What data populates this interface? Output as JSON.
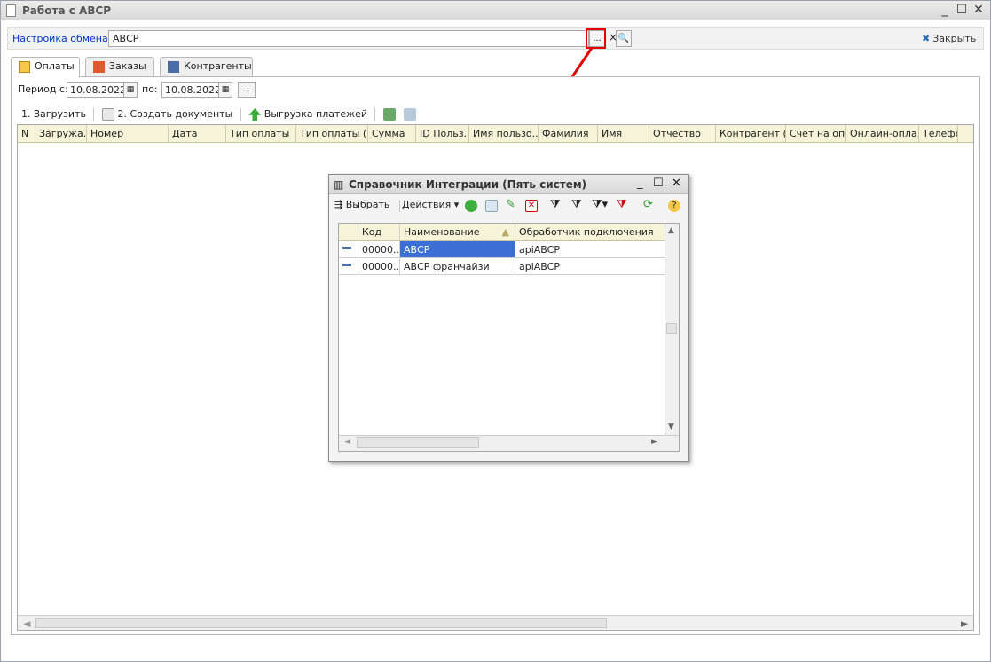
{
  "window": {
    "title": "Работа с АВСР"
  },
  "top": {
    "link": "Настройка обмена",
    "field_value": "АВСР",
    "dots": "...",
    "clear": "×",
    "search": "🔍",
    "close": "Закрыть"
  },
  "tabs": [
    {
      "label": "Оплаты"
    },
    {
      "label": "Заказы"
    },
    {
      "label": "Контрагенты"
    }
  ],
  "period": {
    "label_from": "Период с:",
    "from": "10.08.2022",
    "label_to": "по:",
    "to": "10.08.2022",
    "more": "..."
  },
  "toolbar": {
    "load": "1. Загрузить",
    "create": "2. Создать документы",
    "export": "Выгрузка платежей"
  },
  "grid_columns": [
    "N",
    "Загружа...",
    "Номер",
    "Дата",
    "Тип оплаты",
    "Тип оплаты (I...",
    "Сумма",
    "ID Польз...",
    "Имя пользо...",
    "Фамилия",
    "Имя",
    "Отчество",
    "Контрагент (...",
    "Счет на оп...",
    "Онлайн-опла...",
    "Телефон"
  ],
  "dialog": {
    "title": "Справочник Интеграции (Пять систем)",
    "select": "Выбрать",
    "actions": "Действия",
    "columns": [
      "Код",
      "Наименование",
      "Обработчик подключения"
    ],
    "rows": [
      {
        "code": "00000...",
        "name": "АВСР",
        "handler": "apiABCP"
      },
      {
        "code": "00000...",
        "name": "АВСР франчайзи",
        "handler": "apiABCP"
      }
    ]
  },
  "colors": {
    "accent_red": "#e00000",
    "selection": "#3b6fd6",
    "header_bg": "#f6f4d8"
  }
}
